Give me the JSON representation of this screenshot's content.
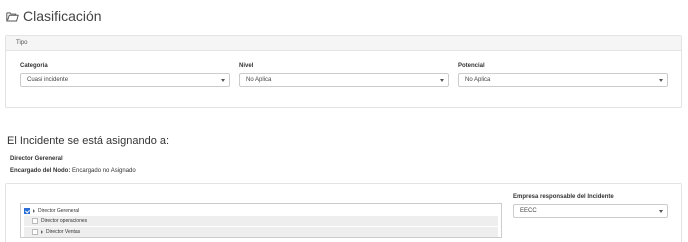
{
  "header": {
    "title": "Clasificación",
    "icon": "folder-open-icon"
  },
  "tipo_panel": {
    "title": "Tipo",
    "categoria": {
      "label": "Categoría",
      "value": "Cuasi incidente"
    },
    "nivel": {
      "label": "Nivel",
      "value": "No Aplica"
    },
    "potencial": {
      "label": "Potencial",
      "value": "No Aplica"
    }
  },
  "assignment": {
    "heading": "El Incidente se está asignando a:",
    "name": "Director Gereneral",
    "owner_label": "Encargado del Nodo:",
    "owner_value": "Encargado no Asignado"
  },
  "tree": {
    "items": [
      {
        "label": "Director Gereneral",
        "checked": true
      },
      {
        "label": "Director operaciones",
        "checked": false
      },
      {
        "label": "Director Ventas",
        "checked": false
      }
    ]
  },
  "empresa": {
    "label": "Empresa responsable del Incidente",
    "value": "EECC"
  },
  "colors": {
    "accent": "#2a6fd6",
    "panel_header": "#f5f5f5",
    "border": "#e3e3e3"
  }
}
